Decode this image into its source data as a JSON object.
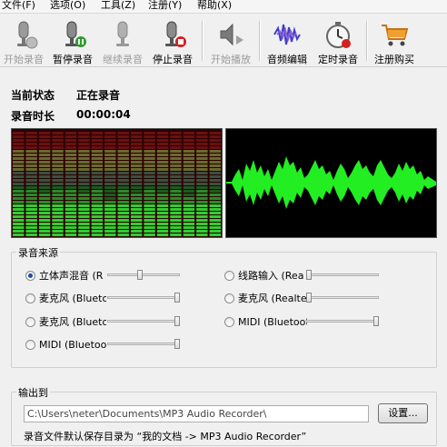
{
  "menu": [
    "文件(F)",
    "选项(O)",
    "工具(Z)",
    "注册(Y)",
    "帮助(X)"
  ],
  "toolbar": [
    {
      "label": "开始录音",
      "icon": "microphone-start-icon",
      "enabled": false
    },
    {
      "label": "暂停录音",
      "icon": "microphone-pause-icon",
      "enabled": true
    },
    {
      "label": "继续录音",
      "icon": "microphone-resume-icon",
      "enabled": false
    },
    {
      "label": "停止录音",
      "icon": "microphone-stop-icon",
      "enabled": true
    },
    {
      "label": "开始播放",
      "icon": "speaker-play-icon",
      "enabled": false
    },
    {
      "label": "音频编辑",
      "icon": "waveform-edit-icon",
      "enabled": true
    },
    {
      "label": "定时录音",
      "icon": "timer-clock-icon",
      "enabled": true
    },
    {
      "label": "注册购买",
      "icon": "shopping-cart-icon",
      "enabled": true
    }
  ],
  "status": {
    "state_label": "当前状态",
    "state_value": "正在录音",
    "time_label": "录音时长",
    "time_value": "00:00:04"
  },
  "vu_levels": [
    0.45,
    0.45,
    0.4,
    0.45,
    0.45,
    0.4,
    0.45,
    0.35,
    0.45,
    0.4,
    0.45,
    0.42,
    0.45,
    0.38,
    0.45,
    0.4
  ],
  "source": {
    "title": "录音来源",
    "items": [
      {
        "label": "立体声混音 (R",
        "checked": true,
        "level": 0.45
      },
      {
        "label": "线路输入 (Rea",
        "checked": false,
        "level": 0.0
      },
      {
        "label": "麦克风 (Blueto",
        "checked": false,
        "level": 1.0
      },
      {
        "label": "麦克风 (Realte",
        "checked": false,
        "level": 0.0
      },
      {
        "label": "麦克风 (Blueto",
        "checked": false,
        "level": 1.0
      },
      {
        "label": "MIDI (Bluetoot",
        "checked": false,
        "level": 1.0
      },
      {
        "label": "MIDI (Bluetoot",
        "checked": false,
        "level": 1.0
      }
    ]
  },
  "output": {
    "title": "输出到",
    "path": "C:\\Users\\neter\\Documents\\MP3 Audio Recorder\\",
    "settings_label": "设置...",
    "note": "录音文件默认保存目录为 “我的文档 -> MP3 Audio Recorder”"
  },
  "colors": {
    "vu_green": "#33cc33",
    "vu_red": "#6a1010",
    "wave_green": "#22ee22"
  }
}
